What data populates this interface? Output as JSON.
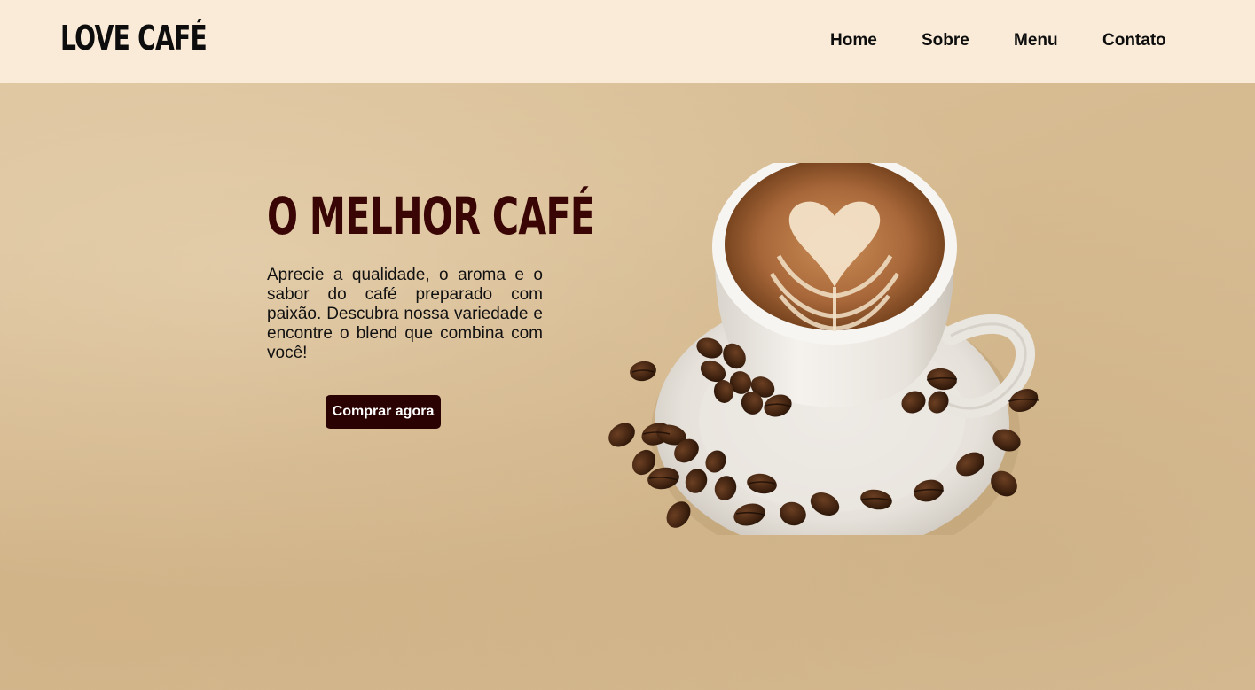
{
  "header": {
    "logo": "LOVE CAFÉ",
    "nav": {
      "home": "Home",
      "sobre": "Sobre",
      "menu": "Menu",
      "contato": "Contato"
    }
  },
  "hero": {
    "title": "O MELHOR CAFÉ",
    "description": "Aprecie a qualidade, o aroma e o sabor do café preparado com paixão. Descubra nossa variedade e encontre o blend que combina com você!",
    "cta_label": "Comprar agora",
    "image": "coffee-cup-with-latte-art-and-beans"
  },
  "colors": {
    "header_bg": "#f9ebd8",
    "hero_bg": "#d7bd94",
    "title": "#3a0505",
    "button_bg": "#2b0202",
    "button_text": "#ffffff"
  }
}
